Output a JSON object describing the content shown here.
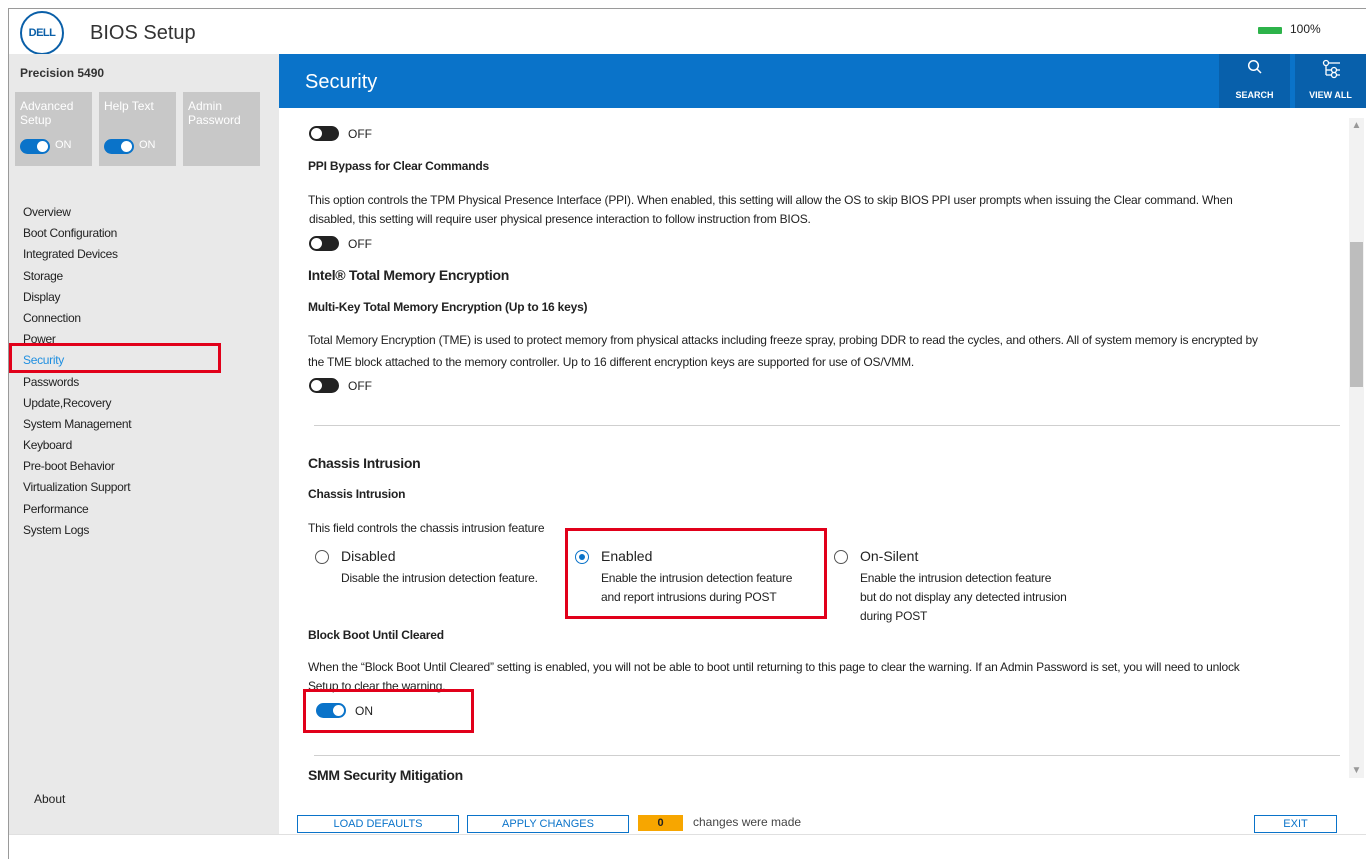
{
  "app": {
    "logo_text": "DELL",
    "title": "BIOS Setup",
    "battery": "100%"
  },
  "sidebar": {
    "model": "Precision 5490",
    "tiles": [
      {
        "label": "Advanced Setup",
        "state": "ON",
        "has_toggle": true
      },
      {
        "label": "Help Text",
        "state": "ON",
        "has_toggle": true
      },
      {
        "label": "Admin Password",
        "has_toggle": false
      }
    ],
    "items": [
      {
        "label": "Overview"
      },
      {
        "label": "Boot Configuration"
      },
      {
        "label": "Integrated Devices"
      },
      {
        "label": "Storage"
      },
      {
        "label": "Display"
      },
      {
        "label": "Connection"
      },
      {
        "label": "Power"
      },
      {
        "label": "Security",
        "active": true
      },
      {
        "label": "Passwords"
      },
      {
        "label": "Update,Recovery"
      },
      {
        "label": "System Management"
      },
      {
        "label": "Keyboard"
      },
      {
        "label": "Pre-boot Behavior"
      },
      {
        "label": "Virtualization Support"
      },
      {
        "label": "Performance"
      },
      {
        "label": "System Logs"
      }
    ],
    "about": "About"
  },
  "header": {
    "title": "Security",
    "search_label": "SEARCH",
    "viewall_label": "VIEW ALL",
    "search_icon": "search-icon",
    "viewall_icon": "view-all-icon"
  },
  "content": {
    "top_toggle_state": "OFF",
    "ppi": {
      "title": "PPI Bypass for Clear Commands",
      "desc1": "This option controls the TPM Physical Presence Interface (PPI). When enabled, this setting will allow the OS to skip BIOS PPI user prompts when issuing the Clear command. When",
      "desc2": "disabled, this setting will require user physical presence interaction to follow instruction from BIOS.",
      "state": "OFF"
    },
    "tme": {
      "section": "Intel® Total Memory Encryption",
      "title": "Multi-Key Total Memory Encryption (Up to 16 keys)",
      "desc1": "Total Memory Encryption (TME) is used to protect memory from physical attacks including freeze spray, probing DDR to read the cycles, and others. All of system memory is encrypted by",
      "desc2": "the TME block attached to the memory controller. Up to 16 different encryption keys are supported for use of OS/VMM.",
      "state": "OFF"
    },
    "chassis": {
      "section": "Chassis Intrusion",
      "title": "Chassis Intrusion",
      "desc": "This field controls the chassis intrusion feature",
      "options": [
        {
          "title": "Disabled",
          "desc": [
            "Disable the intrusion detection feature."
          ],
          "checked": false
        },
        {
          "title": "Enabled",
          "desc": [
            "Enable the intrusion detection feature",
            "and report intrusions during POST"
          ],
          "checked": true
        },
        {
          "title": "On-Silent",
          "desc": [
            "Enable the intrusion detection feature",
            "but do not display any detected intrusion",
            "during POST"
          ],
          "checked": false
        }
      ]
    },
    "block_boot": {
      "title": "Block Boot Until Cleared",
      "desc1": "When the “Block Boot Until Cleared” setting is enabled, you will not be able to boot until returning to this page to clear the warning. If an Admin Password is set, you will need to unlock",
      "desc2": "Setup to clear the warning.",
      "state": "ON"
    },
    "smm": {
      "section": "SMM Security Mitigation"
    }
  },
  "footer": {
    "load_defaults": "LOAD DEFAULTS",
    "apply_changes": "APPLY CHANGES",
    "changes_count": "0",
    "changes_msg": "changes were made",
    "exit": "EXIT"
  },
  "colors": {
    "accent": "#0a73c9",
    "highlight": "#e1001a",
    "counter": "#f7a600"
  }
}
